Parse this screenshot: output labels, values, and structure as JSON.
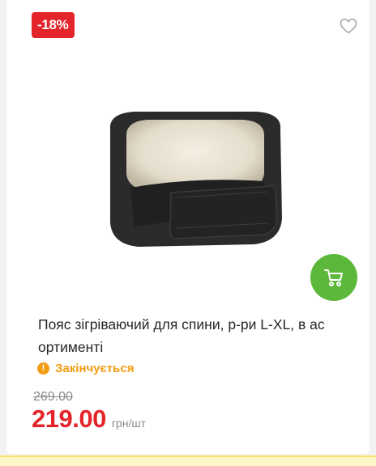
{
  "product": {
    "discount_badge": "-18%",
    "title": "Пояс зігріваючий для спини, р-ри L-XL, в ас ортименті",
    "stock_status": "Закінчується",
    "stock_icon": "warning-icon",
    "old_price": "269.00",
    "price": "219.00",
    "price_unit": "грн/шт"
  },
  "icons": {
    "favorite": "heart-outline-icon",
    "cart": "shopping-cart-icon"
  },
  "colors": {
    "discount": "#e3242b",
    "price": "#e3242b",
    "cart_button": "#5cb83a",
    "stock_warning": "#f39c12"
  }
}
